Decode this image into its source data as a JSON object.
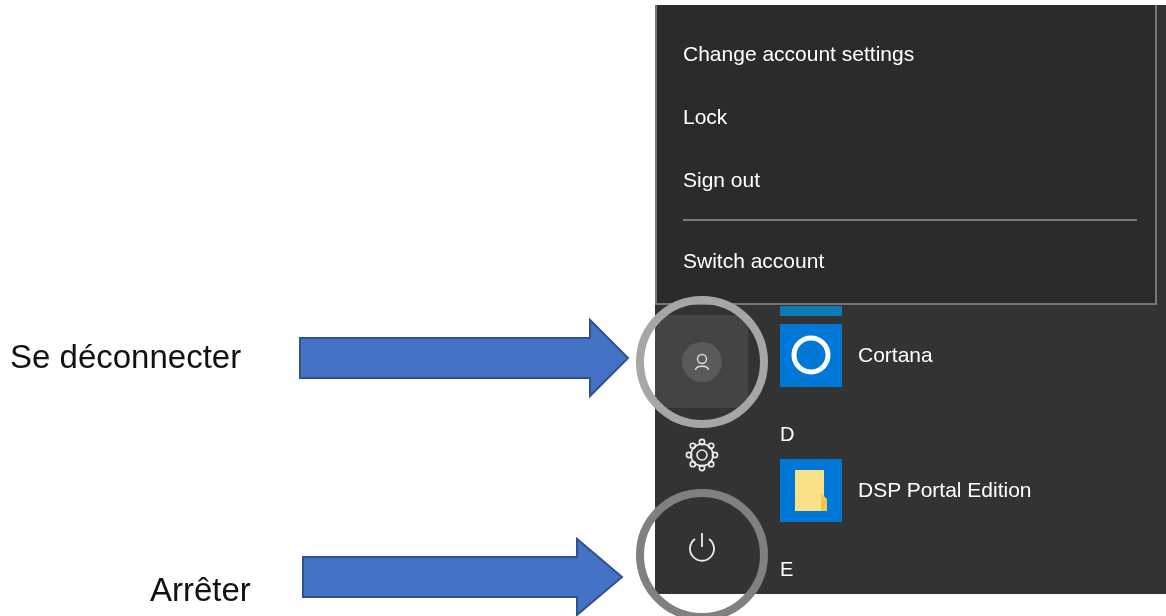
{
  "account_menu": {
    "groups": [
      [
        {
          "label": "Change account settings"
        },
        {
          "label": "Lock"
        },
        {
          "label": "Sign out"
        }
      ],
      [
        {
          "label": "Switch account"
        }
      ]
    ]
  },
  "app_list": [
    {
      "kind": "ringapp",
      "name": "Cortana"
    },
    {
      "kind": "header",
      "label": "D"
    },
    {
      "kind": "folderapp",
      "name": "DSP Portal Edition"
    },
    {
      "kind": "header",
      "label": "E"
    }
  ],
  "annotations": [
    {
      "label": "Se déconnecter"
    },
    {
      "label": "Arrêter"
    }
  ]
}
